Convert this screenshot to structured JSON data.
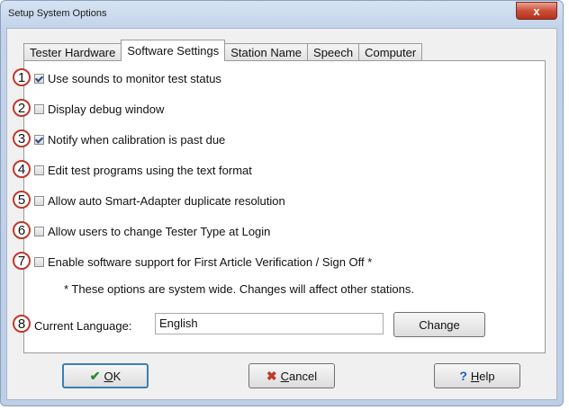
{
  "window": {
    "title": "Setup System Options",
    "close_symbol": "x"
  },
  "tabs": [
    {
      "label": "Tester Hardware",
      "active": false
    },
    {
      "label": "Software Settings",
      "active": true
    },
    {
      "label": "Station Name",
      "active": false
    },
    {
      "label": "Speech",
      "active": false
    },
    {
      "label": "Computer",
      "active": false
    }
  ],
  "options": [
    {
      "num": "1",
      "label": "Use sounds to monitor test status",
      "checked": true
    },
    {
      "num": "2",
      "label": "Display debug window",
      "checked": false
    },
    {
      "num": "3",
      "label": "Notify when calibration is past due",
      "checked": true
    },
    {
      "num": "4",
      "label": "Edit test programs using the text format",
      "checked": false
    },
    {
      "num": "5",
      "label": "Allow auto Smart-Adapter duplicate resolution",
      "checked": false
    },
    {
      "num": "6",
      "label": "Allow users to change Tester Type at Login",
      "checked": false
    },
    {
      "num": "7",
      "label": "Enable software support for First Article Verification / Sign Off *",
      "checked": false
    }
  ],
  "note": "* These options are system wide. Changes will affect other stations.",
  "language": {
    "num": "8",
    "label": "Current Language:",
    "value": "English",
    "change_label": "Change"
  },
  "buttons": {
    "ok_icon": "✔",
    "ok_mnemonic": "O",
    "ok_rest": "K",
    "cancel_icon": "✖",
    "cancel_mnemonic": "C",
    "cancel_rest": "ancel",
    "help_icon": "?",
    "help_mnemonic": "H",
    "help_rest": "elp"
  },
  "colors": {
    "badge_border": "#c0392b",
    "ok_green": "#2e8b2e",
    "cancel_red": "#c0392b",
    "help_blue": "#1f5fbf"
  }
}
